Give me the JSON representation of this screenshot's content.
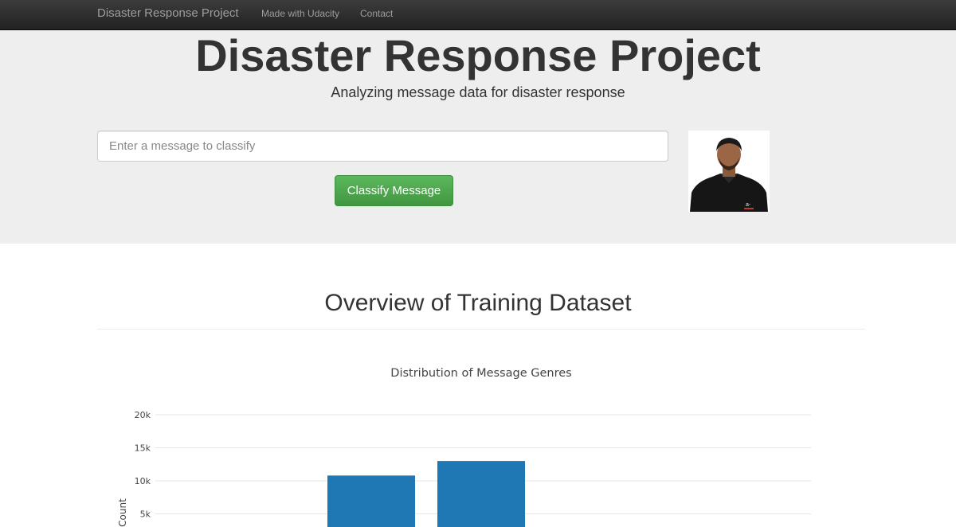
{
  "navbar": {
    "brand": "Disaster Response Project",
    "links": [
      "Made with Udacity",
      "Contact"
    ]
  },
  "jumbotron": {
    "title": "Disaster Response Project",
    "subtitle": "Analyzing message data for disaster response",
    "input_placeholder": "Enter a message to classify",
    "input_value": "",
    "classify_button": "Classify Message"
  },
  "overview": {
    "title": "Overview of Training Dataset"
  },
  "colors": {
    "navbar": "#222222",
    "jumbotron": "#eeeeee",
    "button": "#5cb85c",
    "bar": "#1f77b4"
  },
  "chart_data": {
    "type": "bar",
    "title": "Distribution of Message Genres",
    "ylabel": "Count",
    "xlabel": "",
    "categories": [
      "",
      ""
    ],
    "values": [
      10800,
      13000
    ],
    "ylim": [
      0,
      20000
    ],
    "yticks": [
      5000,
      10000,
      15000,
      20000
    ],
    "ytick_labels": [
      "5k",
      "10k",
      "15k",
      "20k"
    ],
    "grid": true
  }
}
